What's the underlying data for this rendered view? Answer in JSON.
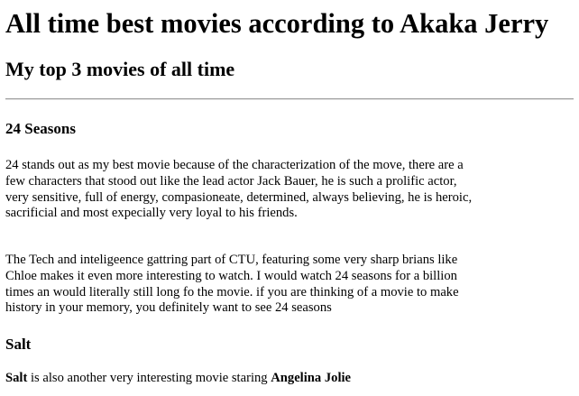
{
  "page": {
    "title": "All time best movies according to Akaka Jerry",
    "subtitle": "My top 3 movies of all time"
  },
  "movies": [
    {
      "heading": "24 Seasons",
      "paragraphs": [
        "24 stands out as my best movie because of the characterization of the move, there are a few characters that stood out like the lead actor Jack Bauer, he is such a prolific actor, very sensitive, full of energy, compasioneate, determined, always believing, he is heroic, sacrificial and most expecially very loyal to his friends.",
        "The Tech and inteligeence gattring part of CTU, featuring some very sharp brians like Chloe makes it even more interesting to watch. I would watch 24 seasons for a billion times an would literally still long fo the movie. if you are thinking of a movie to make history in your memory, you definitely want to see 24 seasons"
      ]
    },
    {
      "heading": "Salt",
      "intro_bold": "Salt",
      "intro_text": " is also another very interesting movie staring ",
      "intro_actor": "Angelina Jolie"
    }
  ]
}
